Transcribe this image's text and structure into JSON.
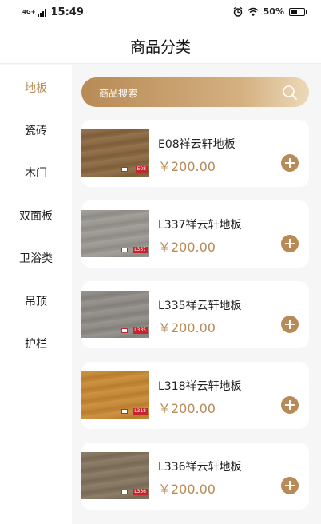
{
  "status": {
    "network": "4G+",
    "time": "15:49",
    "battery": "50%",
    "battery_level": 0.5
  },
  "header": {
    "title": "商品分类"
  },
  "sidebar": {
    "items": [
      {
        "label": "地板",
        "active": true
      },
      {
        "label": "瓷砖"
      },
      {
        "label": "木门"
      },
      {
        "label": "双面板"
      },
      {
        "label": "卫浴类"
      },
      {
        "label": "吊顶"
      },
      {
        "label": "护栏"
      }
    ]
  },
  "search": {
    "placeholder": "商品搜索"
  },
  "products": [
    {
      "name": "E08祥云轩地板",
      "price": "￥200.00",
      "code": "E08",
      "color": "#8a6a45"
    },
    {
      "name": "L337祥云轩地板",
      "price": "￥200.00",
      "code": "L337",
      "color": "#9a9792"
    },
    {
      "name": "L335祥云轩地板",
      "price": "￥200.00",
      "code": "L335",
      "color": "#8f8b86"
    },
    {
      "name": "L318祥云轩地板",
      "price": "￥200.00",
      "code": "L318",
      "color": "#c48a3a"
    },
    {
      "name": "L336祥云轩地板",
      "price": "￥200.00",
      "code": "L336",
      "color": "#837560"
    }
  ],
  "colors": {
    "accent": "#b88a55",
    "badge": "#c8242d"
  }
}
